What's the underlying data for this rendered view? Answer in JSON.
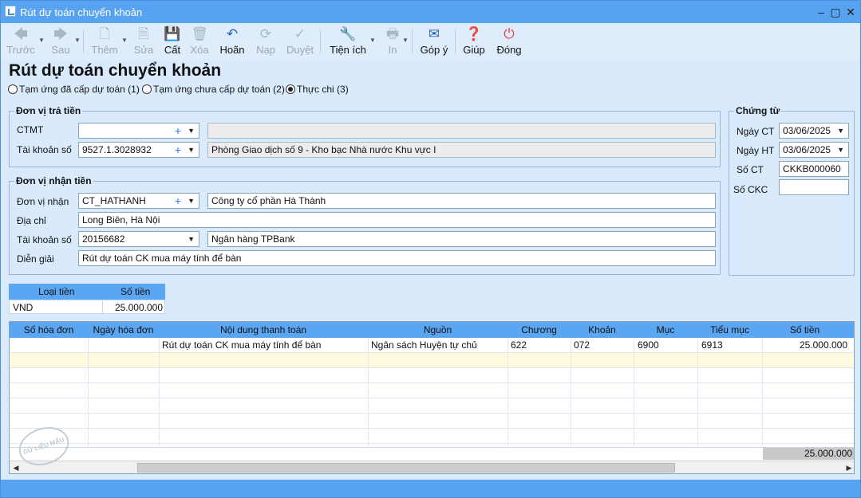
{
  "window": {
    "title": "Rút dự toán chuyển khoản"
  },
  "toolbar": {
    "prev": "Trước",
    "next": "Sau",
    "add": "Thêm",
    "edit": "Sửa",
    "save": "Cất",
    "delete": "Xóa",
    "undo": "Hoãn",
    "load": "Nạp",
    "approve": "Duyệt",
    "utility": "Tiện ích",
    "print": "In",
    "feedback": "Góp ý",
    "help": "Giúp",
    "close": "Đóng"
  },
  "heading": "Rút dự toán chuyển khoản",
  "radio_options": [
    {
      "label": "Tạm ứng đã cấp dự toán (1)",
      "checked": false
    },
    {
      "label": "Tạm ứng chưa cấp dự toán (2)",
      "checked": false
    },
    {
      "label": "Thực chi (3)",
      "checked": true
    }
  ],
  "payer": {
    "legend": "Đơn vị trả tiền",
    "ctmt_label": "CTMT",
    "ctmt_value": "",
    "ctmt_desc": "",
    "account_label": "Tài khoản số",
    "account_value": "9527.1.3028932",
    "account_desc": "Phòng Giao dịch số 9 - Kho bạc Nhà nước Khu vực I"
  },
  "payee": {
    "legend": "Đơn vị nhận tiền",
    "unit_label": "Đơn vị nhận",
    "unit_value": "CT_HATHANH",
    "unit_desc": "Công ty cổ phần Hà Thành",
    "address_label": "Địa chỉ",
    "address_value": "Long Biên, Hà Nội",
    "account_label": "Tài khoản số",
    "account_value": "20156682",
    "bank": "Ngân hàng TPBank",
    "desc_label": "Diễn giải",
    "desc_value": "Rút dự toán CK mua máy tính để bàn"
  },
  "voucher": {
    "legend": "Chứng từ",
    "date_label": "Ngày CT",
    "date_value": "03/06/2025",
    "posting_label": "Ngày HT",
    "posting_value": "03/06/2025",
    "number_label": "Số CT",
    "number_value": "CKKB000060",
    "ckc_label": "Số CKC",
    "ckc_value": ""
  },
  "currency": {
    "headers": [
      "Loại tiền",
      "Số tiền"
    ],
    "row": [
      "VND",
      "25.000.000"
    ]
  },
  "grid": {
    "headers": [
      "Số hóa đơn",
      "Ngày hóa đơn",
      "Nội dung thanh toán",
      "Nguồn",
      "Chương",
      "Khoản",
      "Mục",
      "Tiểu mục",
      "Số tiền"
    ],
    "rows": [
      [
        "",
        "",
        "Rút dự toán CK mua máy tính để bàn",
        "Ngân sách Huyện tự chủ",
        "622",
        "072",
        "6900",
        "6913",
        "25.000.000"
      ]
    ],
    "total": "25.000.000"
  },
  "watermark": "DỮ LIỆU MẪU"
}
